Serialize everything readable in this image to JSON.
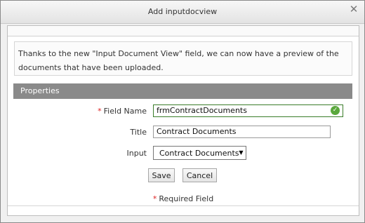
{
  "dialog": {
    "title": "Add inputdocview",
    "close_glyph": "✕"
  },
  "info_text": "Thanks to the new \"Input Document View\" field, we can now have a preview of the documents that have been uploaded.",
  "section": {
    "title": "Properties"
  },
  "form": {
    "required_mark": "*",
    "field_name": {
      "label": "Field Name",
      "value": "frmContractDocuments"
    },
    "title": {
      "label": "Title",
      "value": "Contract Documents"
    },
    "input": {
      "label": "Input",
      "selected": "Contract Documents",
      "arrow": "▼"
    },
    "valid_glyph": "✓"
  },
  "buttons": {
    "save": "Save",
    "cancel": "Cancel"
  },
  "footer": {
    "required_note": "Required Field"
  },
  "colors": {
    "section_header": "#8a8a8a",
    "required": "#dd2222",
    "valid": "#5aa83c"
  }
}
